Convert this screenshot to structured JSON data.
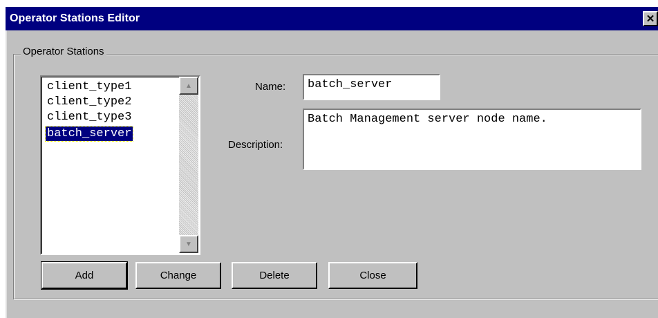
{
  "window": {
    "title": "Operator Stations Editor",
    "close_glyph": "✕"
  },
  "group": {
    "label": "Operator Stations"
  },
  "list": {
    "items": [
      "client_type1",
      "client_type2",
      "client_type3",
      "batch_server"
    ],
    "selected_index": 3
  },
  "form": {
    "name_label": "Name:",
    "name_value": "batch_server",
    "description_label": "Description:",
    "description_value": "Batch Management server node name."
  },
  "buttons": {
    "add": "Add",
    "change": "Change",
    "delete": "Delete",
    "close": "Close"
  },
  "icons": {
    "scroll_up": "▲",
    "scroll_down": "▼",
    "close": "close-icon"
  },
  "colors": {
    "title_bar": "#000080",
    "selection": "#000080",
    "face": "#c0c0c0"
  }
}
